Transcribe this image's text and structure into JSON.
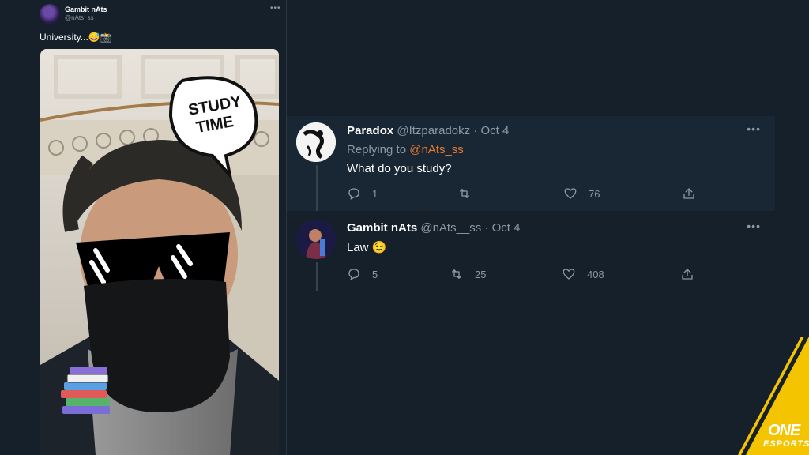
{
  "original_tweet": {
    "display_name": "Gambit nAts",
    "handle": "@nAts_ss",
    "more_icon": "more-horizontal-icon",
    "text": "University...😅📸",
    "photo": {
      "speech_bubble_text_line1": "STUDY",
      "speech_bubble_text_line2": "TIME"
    }
  },
  "replies": [
    {
      "display_name": "Paradox",
      "handle": "@Itzparadokz",
      "date": "· Oct 4",
      "replying_prefix": "Replying to",
      "replying_to": "@nAts_ss",
      "text": "What do you study?",
      "reply_count": "1",
      "retweet_count": "",
      "like_count": "76"
    },
    {
      "display_name": "Gambit nAts",
      "handle": "@nAts__ss",
      "date": "· Oct 4",
      "text": "Law 😉",
      "reply_count": "5",
      "retweet_count": "25",
      "like_count": "408"
    }
  ],
  "brand": {
    "line1": "ONE",
    "line2": "ESPORTS",
    "accent_color": "#f5c400"
  },
  "colors": {
    "background": "#15202b",
    "highlight_row": "#192734",
    "muted_text": "#8b98a5",
    "mention": "#e8772e"
  }
}
